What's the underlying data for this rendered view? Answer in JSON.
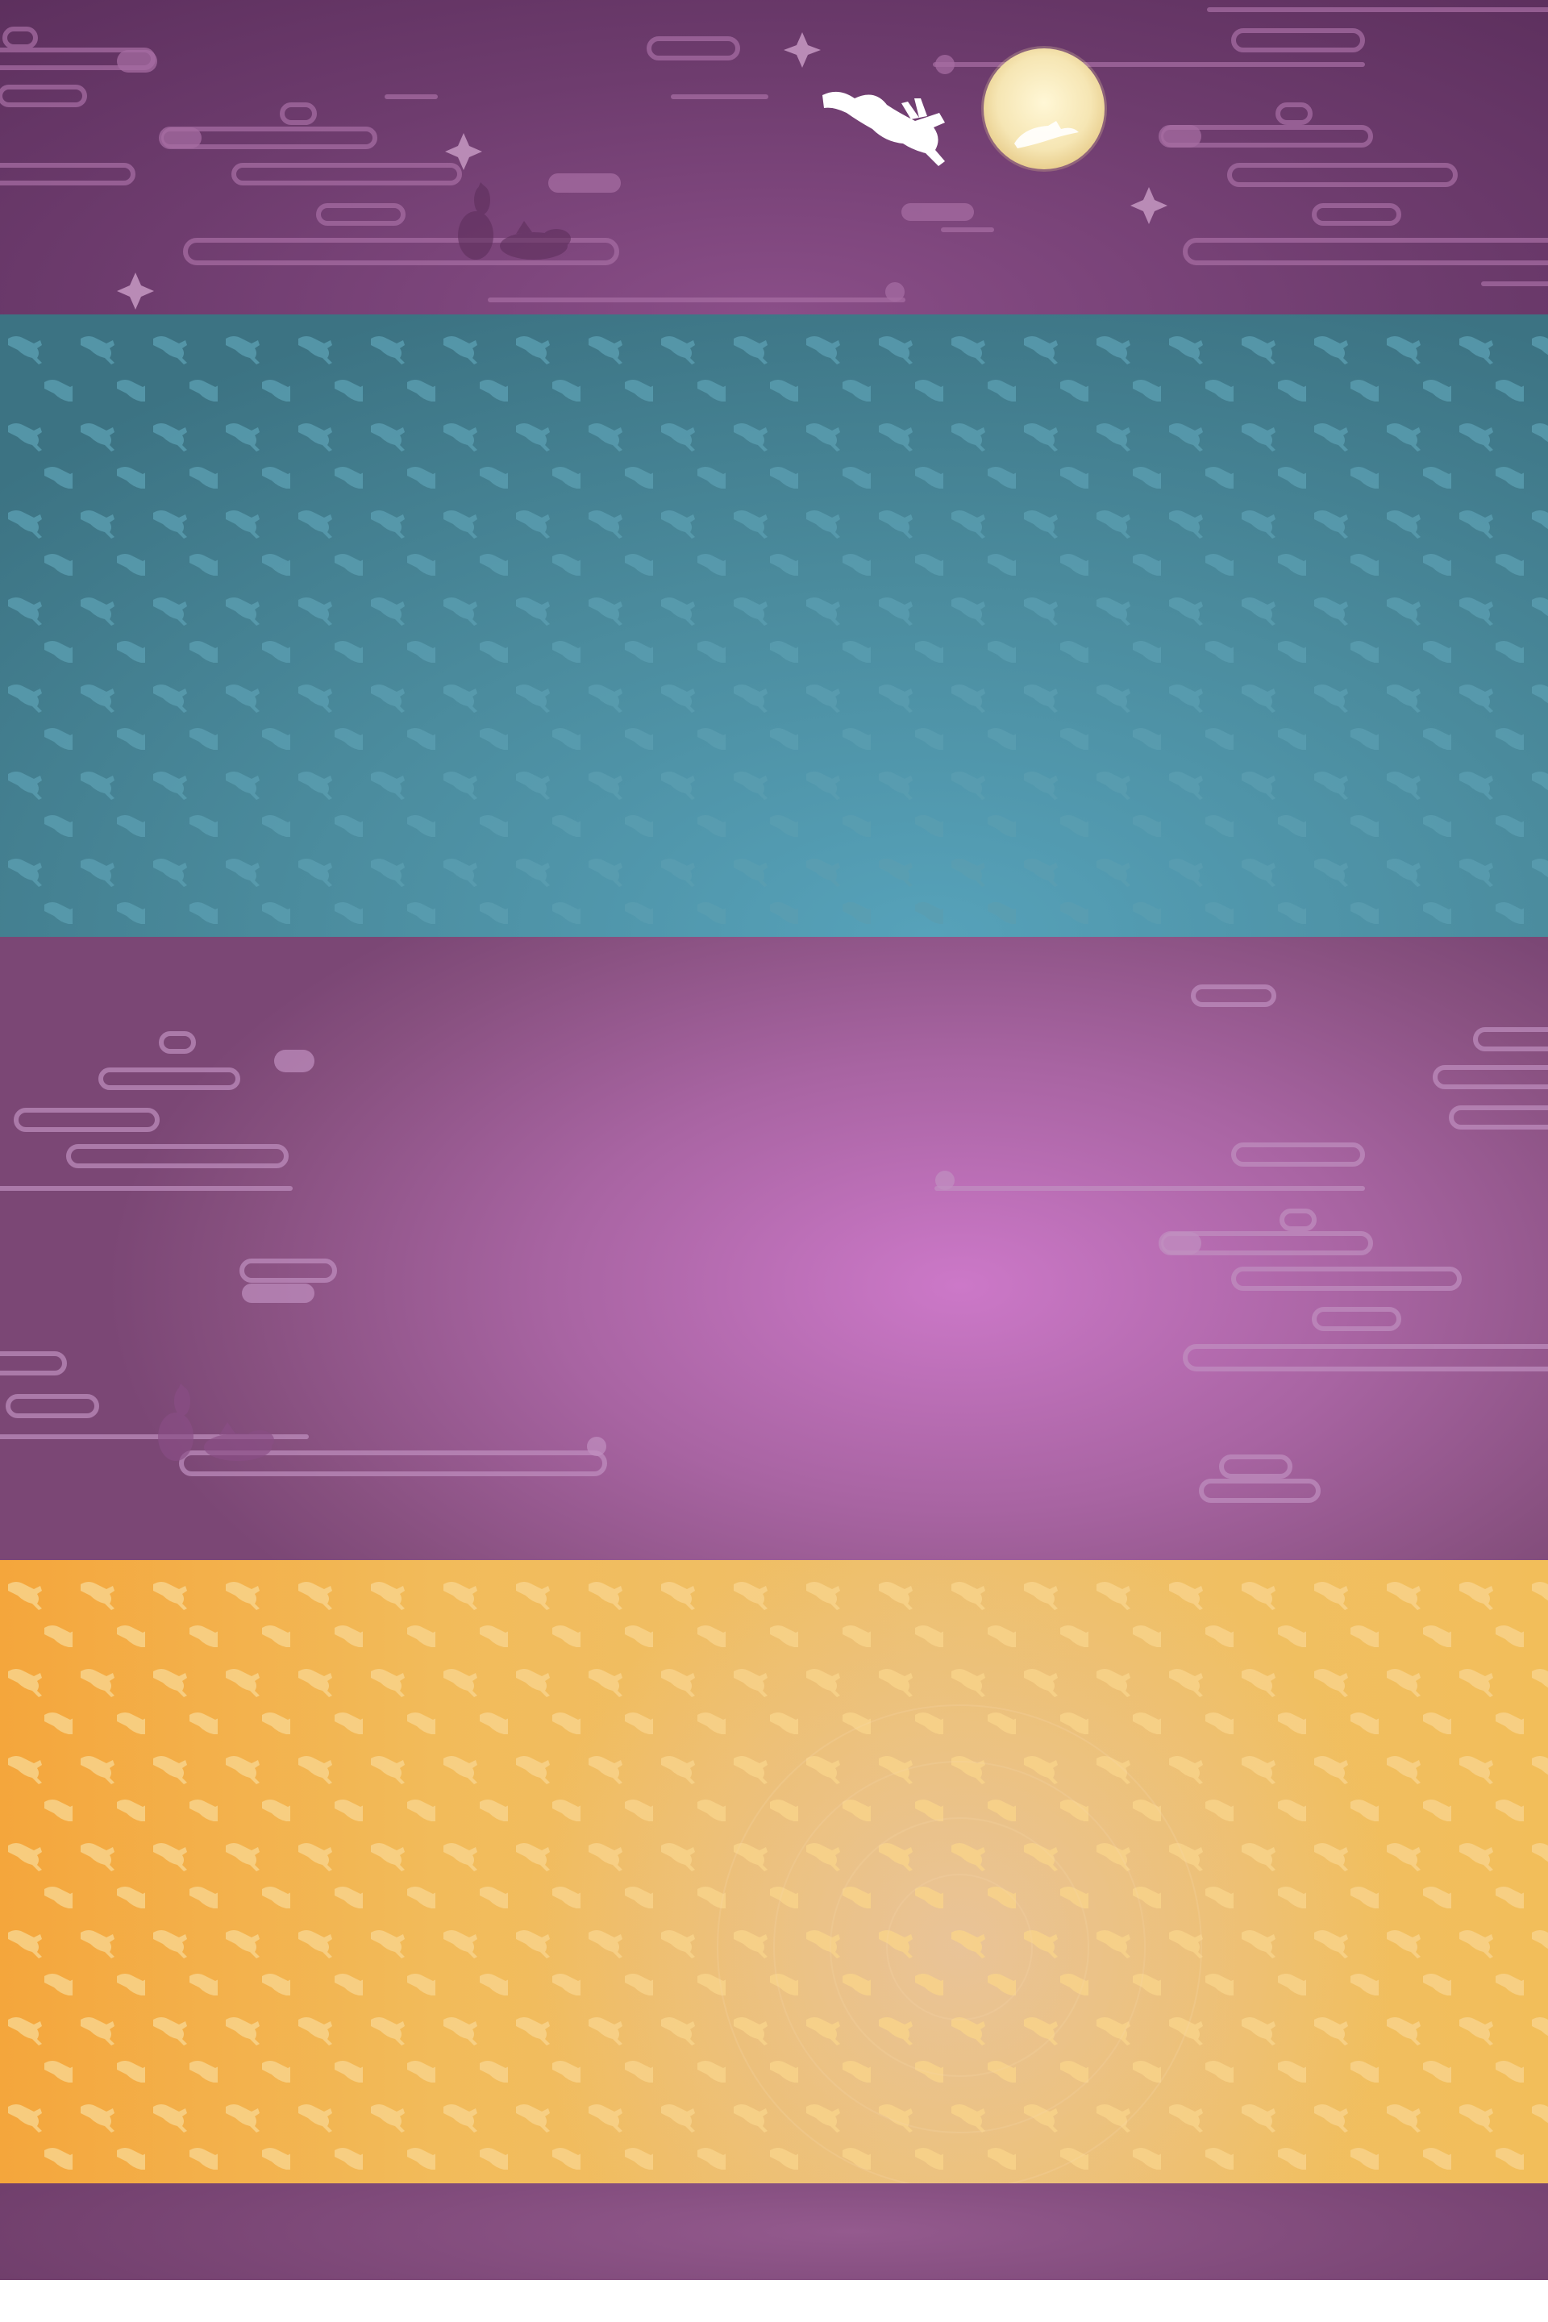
{
  "colors": {
    "night": "#6e3c6e",
    "teal": "#4b8c9e",
    "violet": "#a864a2",
    "gold": "#f0b950",
    "footer": "#7a4675",
    "moon": "#f6e9bd",
    "hare": "#ffffff"
  },
  "icons": [
    "moon-icon",
    "leaping-hare-icon",
    "sitting-rabbit-icon",
    "sparkle-icon",
    "cloud-icon"
  ]
}
